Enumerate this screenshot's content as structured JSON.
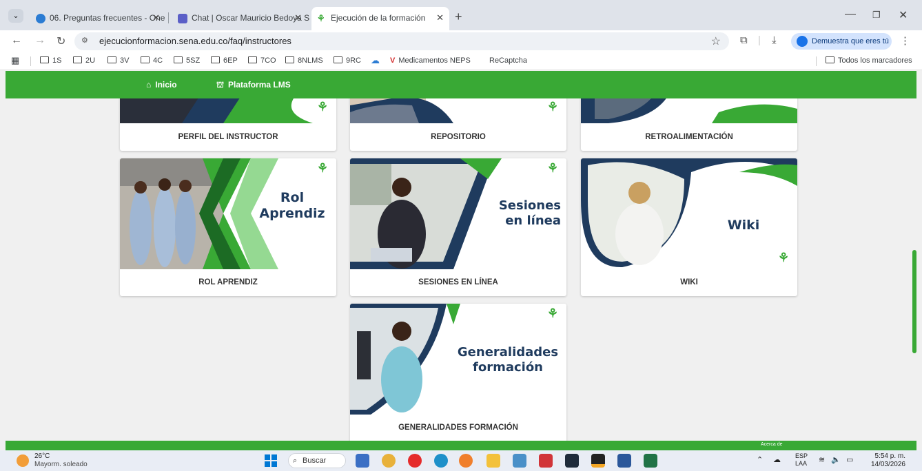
{
  "browser": {
    "tabs": [
      {
        "title": "06. Preguntas frecuentes - One",
        "active": false
      },
      {
        "title": "Chat | Oscar Mauricio Bedoya S",
        "active": false
      },
      {
        "title": "Ejecución de la formación",
        "active": true
      }
    ],
    "url": "ejecucionformacion.sena.edu.co/faq/instructores",
    "verify_label": "Demuestra que eres tú",
    "bookmarks": [
      "1S",
      "2U",
      "3V",
      "4C",
      "5SZ",
      "6EP",
      "7CO",
      "8NLMS",
      "9RC"
    ],
    "bookmark_links": [
      "Medicamentos NEPS",
      "ReCaptcha"
    ],
    "all_bookmarks": "Todos los marcadores"
  },
  "site": {
    "nav": {
      "home": "Inicio",
      "lms": "Plataforma LMS"
    },
    "cards": [
      {
        "caption": "PERFIL DEL INSTRUCTOR",
        "overlay": ""
      },
      {
        "caption": "REPOSITORIO",
        "overlay": ""
      },
      {
        "caption": "RETROALIMENTACIÓN",
        "overlay": ""
      },
      {
        "caption": "ROL APRENDIZ",
        "overlay": "Rol\nAprendiz"
      },
      {
        "caption": "SESIONES EN LÍNEA",
        "overlay": "Sesiones\nen línea"
      },
      {
        "caption": "WIKI",
        "overlay": "Wiki"
      },
      {
        "caption": "GENERALIDADES FORMACIÓN",
        "overlay": "Generalidades\nformación"
      }
    ],
    "footer_link": "Acerca de"
  },
  "taskbar": {
    "temp": "26°C",
    "weather": "Mayorm. soleado",
    "search": "Buscar",
    "lang1": "ESP",
    "lang2": "LAA",
    "time": "5:54 p. m.",
    "date": "14/03/2026"
  },
  "colors": {
    "sena_green": "#39a935",
    "navy": "#1f3b5e"
  }
}
